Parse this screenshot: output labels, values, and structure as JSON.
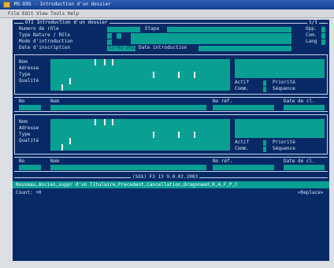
{
  "window": {
    "title": "MS-DOS - Introduction d'un dossier",
    "toolbar_text": "File  Edit  View  Tools  Help"
  },
  "screen": {
    "title": "OTI Introduction d'un dossier",
    "page_indicator": "1/1",
    "fields": {
      "numero_role": "Numero de rôle",
      "etape": "Etape",
      "type_nature_role": "Type  Nature / Rôle",
      "mode_introduction": "Mode d'introduction",
      "date_inscription": "Date d'inscription",
      "date_inscription_value": "17-01-2023",
      "date_introduction": "Date introduction",
      "opp": "Opp.",
      "com": "Com.",
      "lang": "Lang"
    },
    "party_block_1": {
      "nom": "Nom",
      "adresse": "Adresse",
      "type": "Type",
      "qualite": "Qualité",
      "actif": "Actif",
      "priorite": "Priorité",
      "comm": "Comm.",
      "sequence": "Séquence"
    },
    "detail_row_1": {
      "no": "No",
      "nom": "Nom",
      "no_ref": "No réf.",
      "date_de_cl": "Date de cl."
    },
    "party_block_2": {
      "nom": "Nom",
      "adresse": "Adresse",
      "type": "Type",
      "qualite": "Qualité",
      "actif": "Actif",
      "priorite": "Priorité",
      "comm": "Comm.",
      "sequence": "Séquence"
    },
    "detail_row_2": {
      "no": "No",
      "nom": "Nom",
      "no_ref": "No réf.",
      "date_de_cl": "Date de cl."
    },
    "footer_center": "(SGS) F3 13 9.0.02.2083",
    "command_bar": "Nouveau,Ancien,suppr d'un Titulaire,Precedent,Cancellation,Dragonwed,R,A,F,P,C",
    "status_left": "Count: +0",
    "status_right": "<Replace>"
  },
  "colors": {
    "screen_bg": "#072a66",
    "field_teal": "#0a9f93",
    "text_light": "#d9e3f3"
  }
}
